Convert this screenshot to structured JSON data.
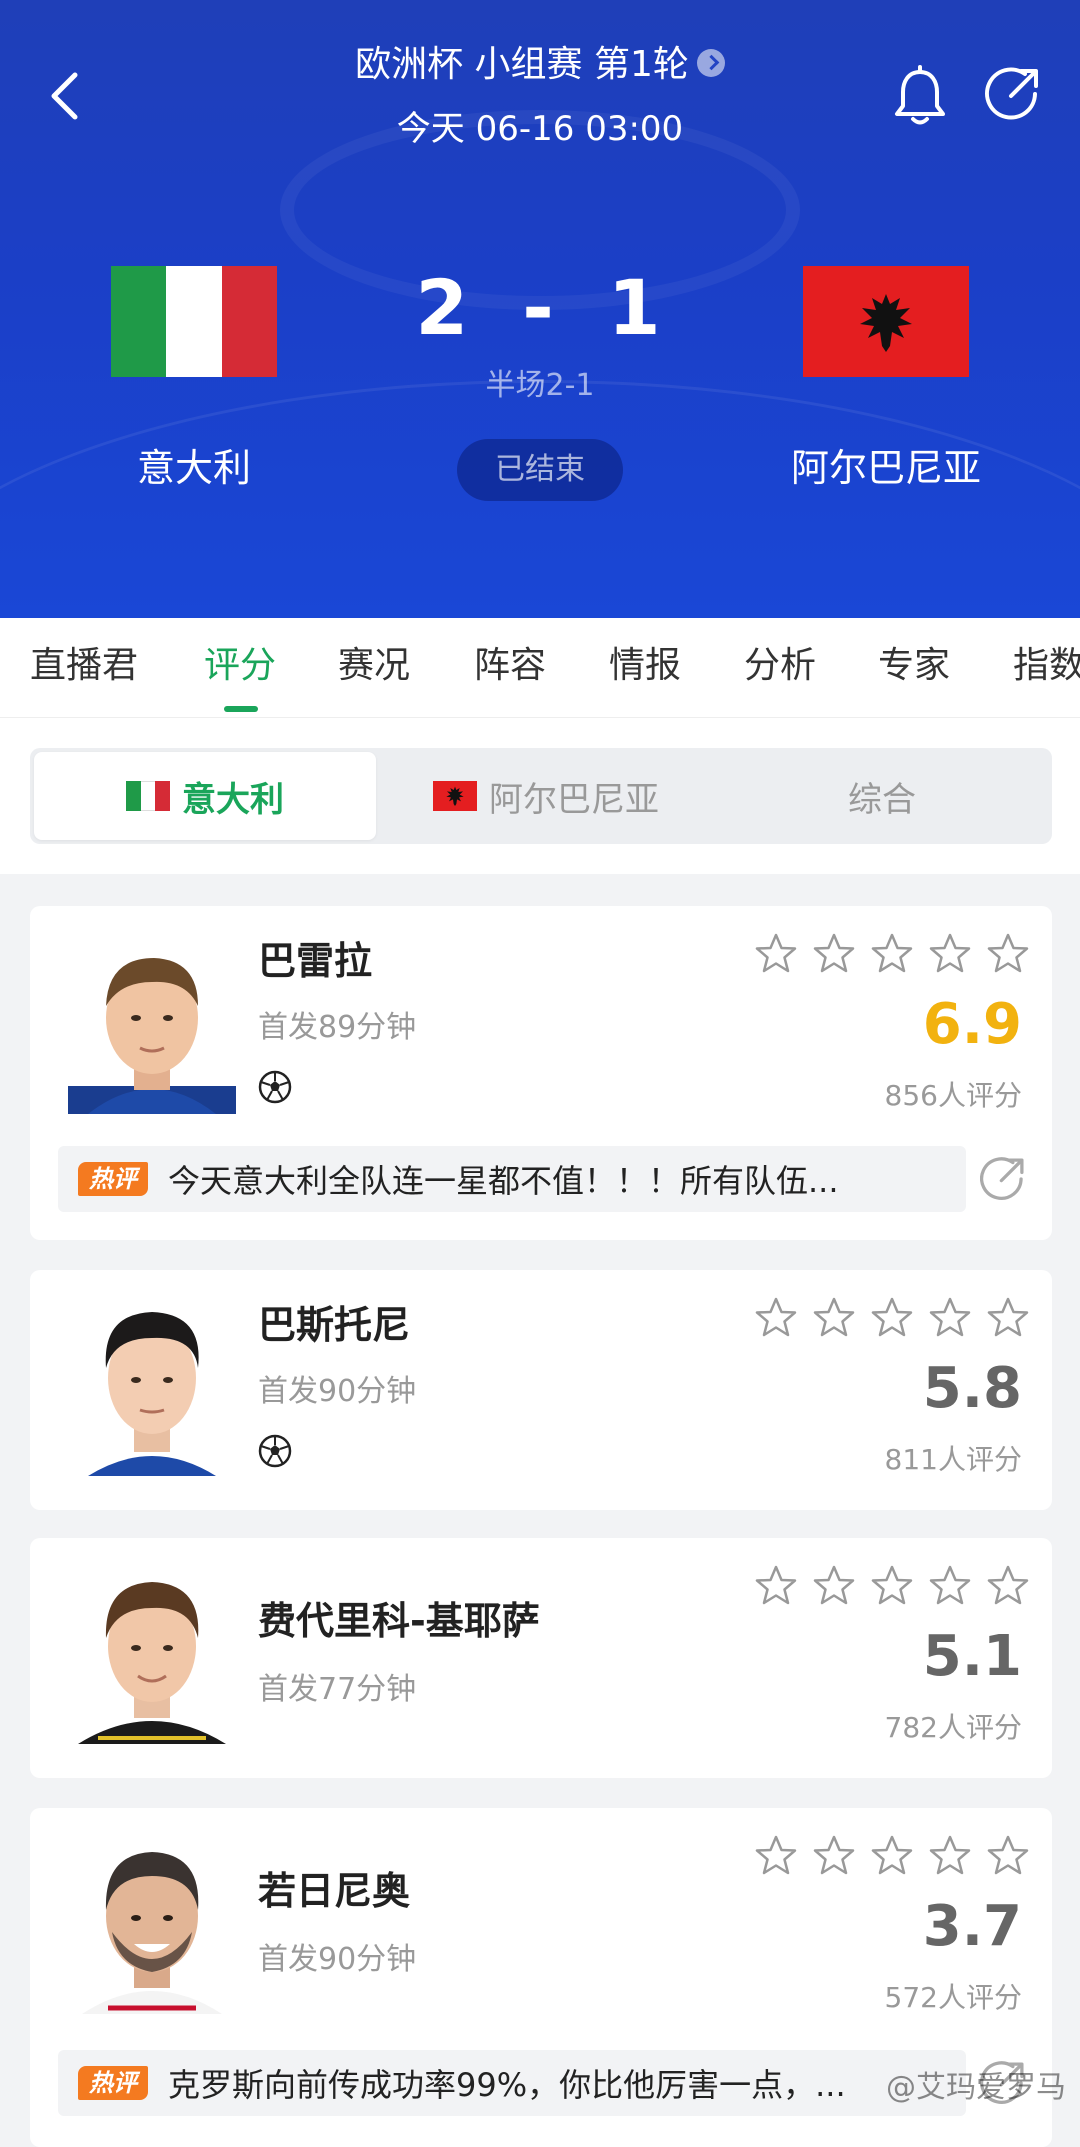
{
  "header": {
    "league": "欧洲杯 小组赛 第1轮",
    "datetime": "今天 06-16 03:00",
    "home_team": "意大利",
    "away_team": "阿尔巴尼亚",
    "home_score": "2",
    "score_sep": "-",
    "away_score": "1",
    "halftime": "半场2-1",
    "status": "已结束",
    "icons": [
      "back-arrow-icon",
      "bell-icon",
      "share-icon"
    ]
  },
  "tabs": [
    "直播君",
    "评分",
    "赛况",
    "阵容",
    "情报",
    "分析",
    "专家",
    "指数"
  ],
  "active_tab": "评分",
  "segment": [
    "意大利",
    "阿尔巴尼亚",
    "综合"
  ],
  "active_segment": "意大利",
  "colors": {
    "accent_green": "#1aa55a",
    "rating_gold": "#f2b20f",
    "header_blue": "#1f3fb8",
    "hot_badge_orange": "#f47a20"
  },
  "players": [
    {
      "name": "巴雷拉",
      "minutes": "首发89分钟",
      "goal": true,
      "stars_filled": 0,
      "rating": "6.9",
      "votes": "856人评分",
      "comment": {
        "badge": "热评",
        "text": "今天意大利全队连一星都不值！！！所有队伍..."
      }
    },
    {
      "name": "巴斯托尼",
      "minutes": "首发90分钟",
      "goal": true,
      "stars_filled": 0,
      "rating": "5.8",
      "votes": "811人评分"
    },
    {
      "name": "费代里科-基耶萨",
      "minutes": "首发77分钟",
      "goal": false,
      "stars_filled": 0,
      "rating": "5.1",
      "votes": "782人评分"
    },
    {
      "name": "若日尼奥",
      "minutes": "首发90分钟",
      "goal": false,
      "stars_filled": 0,
      "rating": "3.7",
      "votes": "572人评分",
      "comment": {
        "badge": "热评",
        "text": "克罗斯向前传成功率99%，你比他厉害一点，..."
      }
    }
  ],
  "watermark": "@艾玛爱罗马"
}
